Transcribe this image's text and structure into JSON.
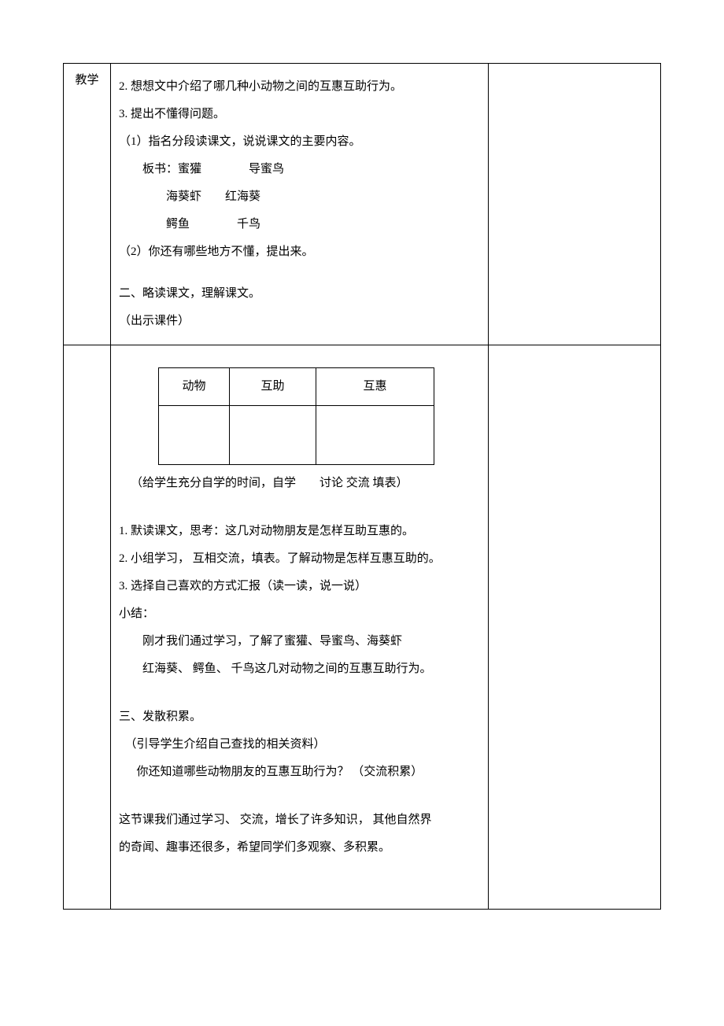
{
  "leftLabel": "教学",
  "section1": {
    "line1": "2. 想想文中介绍了哪几种小动物之间的互惠互助行为。",
    "line2": "3. 提出不懂得问题。",
    "line3": "（1）指名分段读课文，说说课文的主要内容。",
    "line4a": "板书：蜜獾",
    "line4b": "导蜜鸟",
    "line5a": "海葵虾",
    "line5b": "红海葵",
    "line6a": "鳄鱼",
    "line6b": "千鸟",
    "line7": "（2）你还有哪些地方不懂，提出来。",
    "line8": "二、略读课文，理解课文。",
    "line9": "（出示课件）"
  },
  "innerTable": {
    "h1": "动物",
    "h2": "互助",
    "h3": "互惠"
  },
  "section2": {
    "line1a": "（给学生充分自学的时间，自学",
    "line1b": "讨论  交流  填表）",
    "line2": "1. 默读课文，思考：这几对动物朋友是怎样互助互惠的。",
    "line3": "2. 小组学习， 互相交流，填表。了解动物是怎样互惠互助的。",
    "line4": "3. 选择自己喜欢的方式汇报（读一读，说一说）",
    "line5": "小结：",
    "line6": "刚才我们通过学习，了解了蜜獾、导蜜鸟、海葵虾",
    "line7": "红海葵、 鳄鱼、 千鸟这几对动物之间的互惠互助行为。",
    "line8": "三、发散积累。",
    "line9": "（引导学生介绍自己查找的相关资料）",
    "line10": "你还知道哪些动物朋友的互惠互助行为？ （交流积累）",
    "line11": "这节课我们通过学习、  交流，增长了许多知识，  其他自然界",
    "line12": "的奇闻、趣事还很多，希望同学们多观察、多积累。"
  }
}
